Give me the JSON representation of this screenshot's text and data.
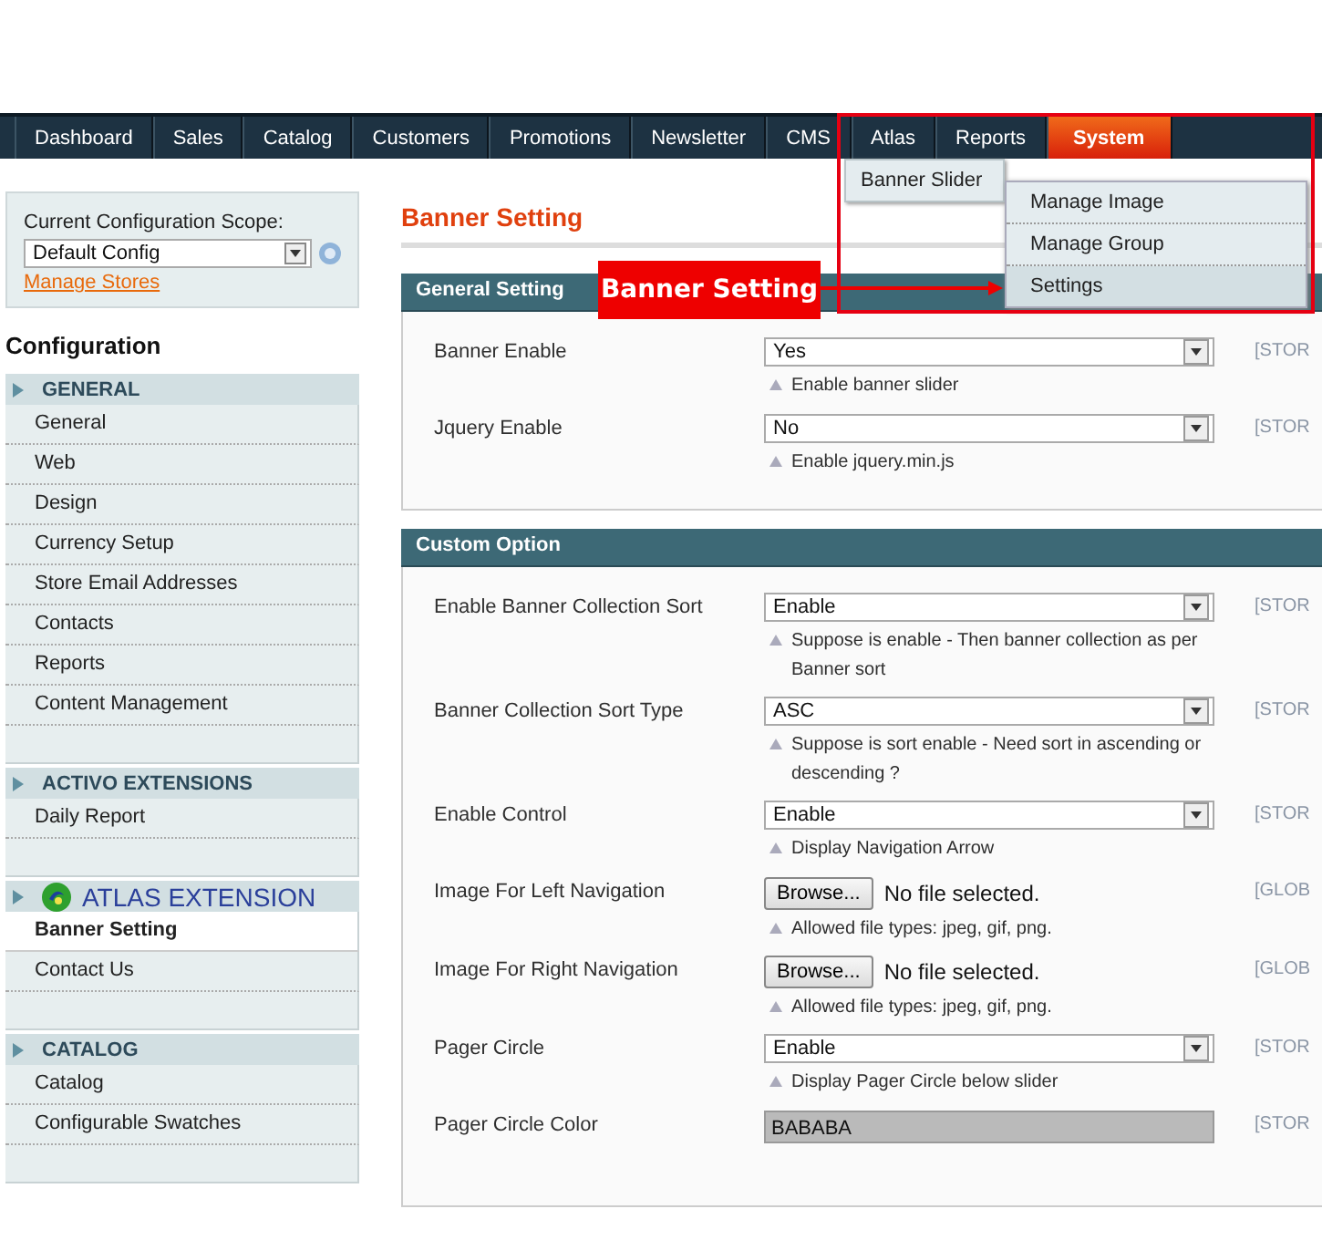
{
  "nav": {
    "tabs": [
      {
        "label": "Dashboard",
        "selected": false
      },
      {
        "label": "Sales",
        "selected": false
      },
      {
        "label": "Catalog",
        "selected": false
      },
      {
        "label": "Customers",
        "selected": false
      },
      {
        "label": "Promotions",
        "selected": false
      },
      {
        "label": "Newsletter",
        "selected": false
      },
      {
        "label": "CMS",
        "selected": false
      },
      {
        "label": "Atlas",
        "selected": false
      },
      {
        "label": "Reports",
        "selected": false
      },
      {
        "label": "System",
        "selected": true
      }
    ],
    "menu": {
      "item": "Banner Slider",
      "submenu": [
        {
          "label": "Manage Image",
          "selected": false
        },
        {
          "label": "Manage Group",
          "selected": false
        },
        {
          "label": "Settings",
          "selected": true
        }
      ]
    }
  },
  "scope": {
    "label": "Current Configuration Scope:",
    "value": "Default Config",
    "link": "Manage Stores"
  },
  "sidebar": {
    "title": "Configuration",
    "sections": [
      {
        "title": "GENERAL",
        "kind": "plain",
        "items": [
          {
            "label": "General",
            "selected": false
          },
          {
            "label": "Web",
            "selected": false
          },
          {
            "label": "Design",
            "selected": false
          },
          {
            "label": "Currency Setup",
            "selected": false
          },
          {
            "label": "Store Email Addresses",
            "selected": false
          },
          {
            "label": "Contacts",
            "selected": false
          },
          {
            "label": "Reports",
            "selected": false
          },
          {
            "label": "Content Management",
            "selected": false
          }
        ]
      },
      {
        "title": "ACTIVO EXTENSIONS",
        "kind": "plain",
        "items": [
          {
            "label": "Daily Report",
            "selected": false
          }
        ]
      },
      {
        "title": "ATLAS EXTENSION",
        "kind": "logo",
        "items": [
          {
            "label": "Banner Setting",
            "selected": true
          },
          {
            "label": "Contact Us",
            "selected": false
          }
        ]
      },
      {
        "title": "CATALOG",
        "kind": "plain",
        "items": [
          {
            "label": "Catalog",
            "selected": false
          },
          {
            "label": "Configurable Swatches",
            "selected": false
          }
        ]
      }
    ]
  },
  "page_title": "Banner Setting",
  "callout": "Banner Setting",
  "groups": [
    {
      "title": "General Setting",
      "fields": [
        {
          "kind": "select",
          "label": "Banner Enable",
          "value": "Yes",
          "hint": "Enable banner slider",
          "scope": "[STOR"
        },
        {
          "kind": "select",
          "label": "Jquery Enable",
          "value": "No",
          "hint": "Enable jquery.min.js",
          "scope": "[STOR"
        }
      ]
    },
    {
      "title": "Custom Option",
      "fields": [
        {
          "kind": "select",
          "label": "Enable Banner Collection Sort",
          "value": "Enable",
          "hint": "Suppose is enable - Then banner collection as per Banner sort",
          "scope": "[STOR"
        },
        {
          "kind": "select",
          "label": "Banner Collection Sort Type",
          "value": "ASC",
          "hint": "Suppose is sort enable - Need sort in ascending or descending ?",
          "scope": "[STOR"
        },
        {
          "kind": "select",
          "label": "Enable Control",
          "value": "Enable",
          "hint": "Display Navigation Arrow",
          "scope": "[STOR"
        },
        {
          "kind": "file",
          "label": "Image For Left Navigation",
          "button": "Browse...",
          "value": "No file selected.",
          "hint": "Allowed file types: jpeg, gif, png.",
          "scope": "[GLOB"
        },
        {
          "kind": "file",
          "label": "Image For Right Navigation",
          "button": "Browse...",
          "value": "No file selected.",
          "hint": "Allowed file types: jpeg, gif, png.",
          "scope": "[GLOB"
        },
        {
          "kind": "select",
          "label": "Pager Circle",
          "value": "Enable",
          "hint": "Display Pager Circle below slider",
          "scope": "[STOR"
        },
        {
          "kind": "color",
          "label": "Pager Circle Color",
          "value": "BABABA",
          "color": "#bababa",
          "scope": "[STOR"
        }
      ]
    }
  ]
}
